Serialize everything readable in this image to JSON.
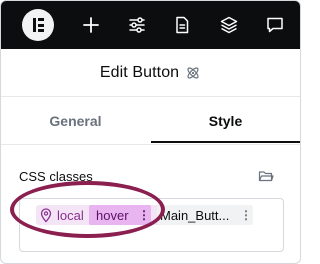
{
  "toolbar": {
    "logo_icon": "elementor-logo-icon",
    "icons": [
      "plus-icon",
      "sliders-icon",
      "page-icon",
      "layers-icon",
      "chat-icon"
    ]
  },
  "header": {
    "title": "Edit Button",
    "icon": "atom-icon"
  },
  "tabs": {
    "general": "General",
    "style": "Style",
    "active": "Style"
  },
  "css_classes": {
    "label": "CSS classes",
    "folder_icon": "folder-icon",
    "chips": {
      "local": {
        "label": "local",
        "icon": "map-pin-icon"
      },
      "state": {
        "label": "hover",
        "menu": "⋮"
      },
      "main": {
        "label": "Main_Butt...",
        "menu": "⋮"
      }
    }
  },
  "colors": {
    "toolbar_bg": "#0c0d0e",
    "chip_local_bg": "#f4e5f6",
    "chip_state_bg": "#e9b5f0",
    "accent_text": "#8a2f8f",
    "annotation_oval": "#8b1f4f"
  }
}
